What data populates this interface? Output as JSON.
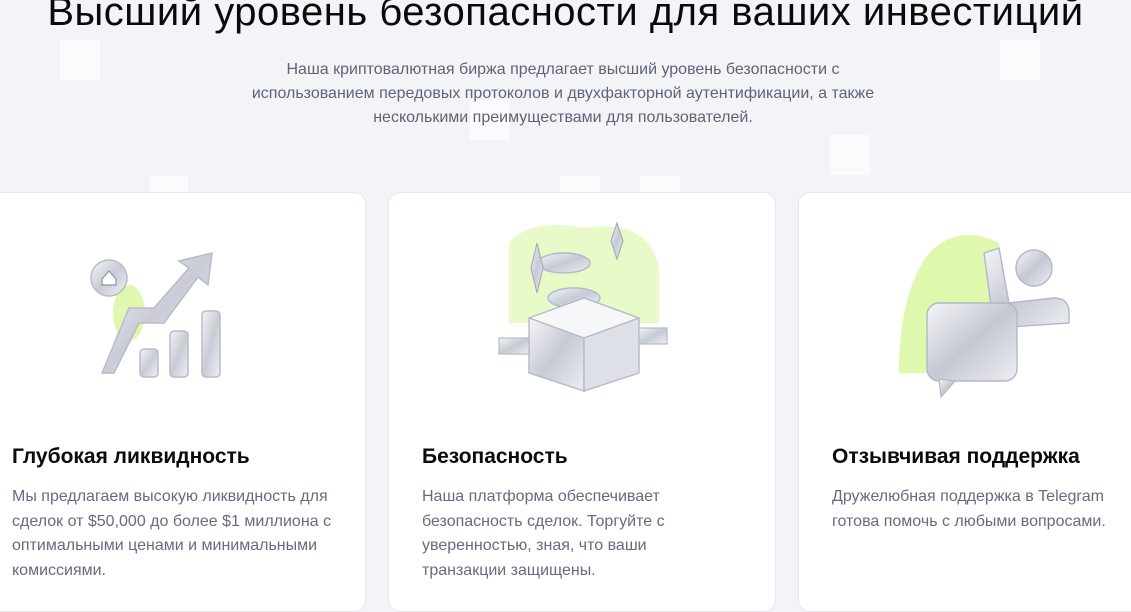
{
  "hero": {
    "title": "Высший уровень безопасности для ваших инвестиций",
    "subtitle": "Наша криптовалютная биржа предлагает высший уровень безопасности с использованием передовых протоколов и двухфакторной аутентификации, а также несколькими преимуществами для пользователей."
  },
  "features": [
    {
      "icon": "growth-chart-icon",
      "title": "Глубокая ликвидность",
      "text": "Мы предлагаем высокую ликвидность для сделок от $50,000 до более $1 миллиона с оптимальными ценами и минимальными комиссиями."
    },
    {
      "icon": "secure-box-icon",
      "title": "Безопасность",
      "text": "Наша платформа обеспечивает безопасность сделок. Торгуйте с уверенностью, зная, что ваши транзакции защищены."
    },
    {
      "icon": "support-chat-icon",
      "title": "Отзывчивая поддержка",
      "text": "Дружелюбная поддержка в Telegram готова помочь с любыми вопросами."
    }
  ],
  "colors": {
    "accent": "#c8f56a",
    "background": "#f3f4f7",
    "card": "#ffffff",
    "muted_text": "#666b80"
  }
}
